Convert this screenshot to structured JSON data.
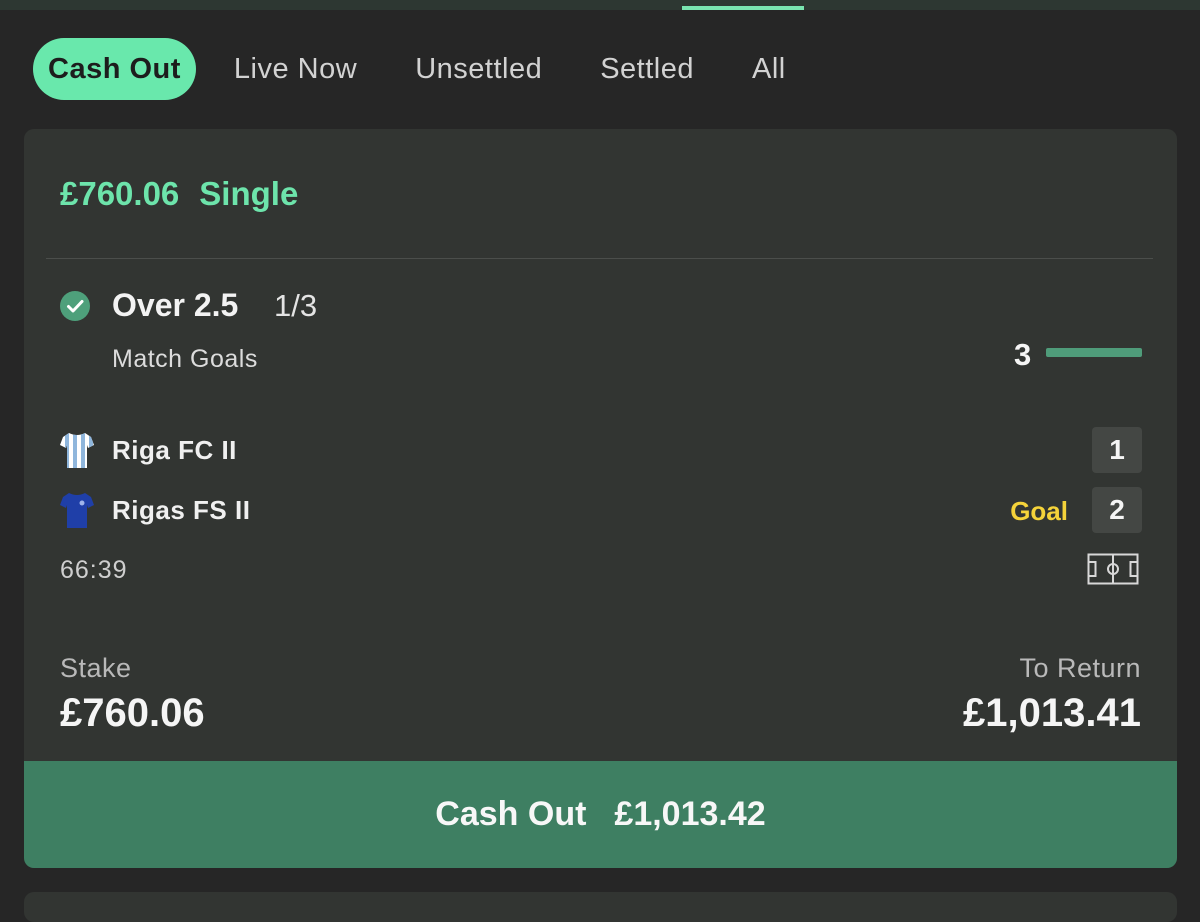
{
  "tabs": [
    {
      "label": "Cash Out",
      "active": true
    },
    {
      "label": "Live Now",
      "active": false
    },
    {
      "label": "Unsettled",
      "active": false
    },
    {
      "label": "Settled",
      "active": false
    },
    {
      "label": "All",
      "active": false
    }
  ],
  "bet": {
    "amount": "£760.06",
    "type": "Single",
    "selection": {
      "status_icon": "check-circle-icon",
      "name": "Over 2.5",
      "odds": "1/3",
      "market": "Match Goals",
      "goals_count": "3",
      "goals_progress": 1.0
    },
    "match": {
      "home": {
        "name": "Riga FC II",
        "score": "1",
        "kit_icon": "striped-shirt-icon"
      },
      "away": {
        "name": "Rigas FS II",
        "score": "2",
        "event": "Goal",
        "kit_icon": "blue-shirt-icon"
      },
      "clock": "66:39",
      "pitch_icon": "pitch-icon"
    },
    "stake_label": "Stake",
    "stake_value": "£760.06",
    "return_label": "To Return",
    "return_value": "£1,013.41",
    "cashout_label": "Cash Out",
    "cashout_value": "£1,013.42"
  },
  "colors": {
    "accent": "#69e8ac",
    "button": "#3e7f62",
    "goal": "#f5d33a",
    "background": "#262626",
    "card": "#323532"
  }
}
